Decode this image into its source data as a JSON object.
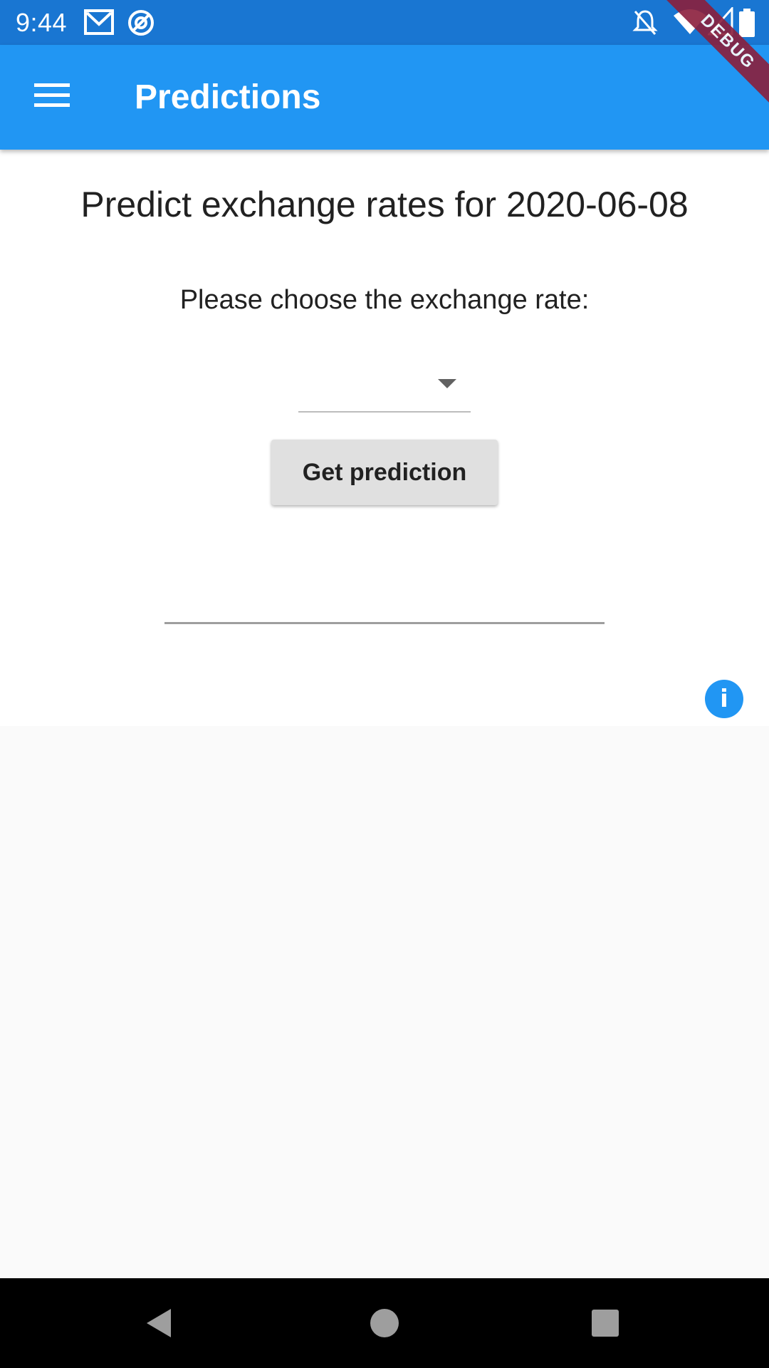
{
  "status_bar": {
    "time": "9:44",
    "icons": [
      "gmail-icon",
      "sync-icon",
      "notifications-off-icon",
      "wifi-icon",
      "signal-icon",
      "battery-icon"
    ]
  },
  "debug_banner": "DEBUG",
  "app_bar": {
    "title": "Predictions",
    "menu_icon": "menu-icon"
  },
  "main": {
    "heading": "Predict exchange rates for 2020-06-08",
    "prompt": "Please choose the exchange rate:",
    "dropdown": {
      "selected": "",
      "icon": "dropdown-arrow-icon"
    },
    "button_label": "Get prediction",
    "result_value": "",
    "info_icon_glyph": "i"
  },
  "nav_bar": {
    "buttons": [
      "back-icon",
      "home-icon",
      "recents-icon"
    ]
  },
  "colors": {
    "primary": "#2196f3",
    "primary_dark": "#1976d2",
    "button": "#e0e0e0",
    "background": "#fafafa"
  }
}
